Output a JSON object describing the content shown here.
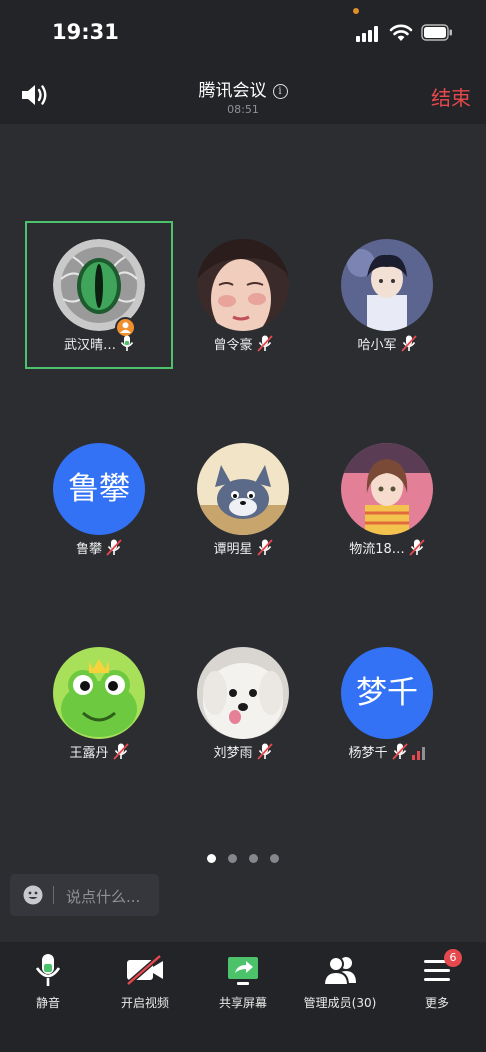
{
  "status_bar": {
    "time": "19:31"
  },
  "header": {
    "title": "腾讯会议",
    "duration": "08:51",
    "end_label": "结束"
  },
  "participants": [
    {
      "name": "武汉晴…",
      "avatar": "dragon-eye-photo",
      "mic": "on",
      "host": true
    },
    {
      "name": "曾令豪",
      "avatar": "illustrated-face",
      "mic": "muted"
    },
    {
      "name": "哈小军",
      "avatar": "anime-boy",
      "mic": "muted"
    },
    {
      "name": "鲁攀",
      "avatar_text": "鲁攀",
      "mic": "muted"
    },
    {
      "name": "谭明星",
      "avatar": "cartoon-cat",
      "mic": "muted"
    },
    {
      "name": "物流18…",
      "avatar": "anime-girl",
      "mic": "muted"
    },
    {
      "name": "王露丹",
      "avatar": "cartoon-frog",
      "mic": "muted"
    },
    {
      "name": "刘梦雨",
      "avatar": "white-puppy",
      "mic": "muted"
    },
    {
      "name": "杨梦千",
      "avatar_text": "梦千",
      "mic": "muted",
      "signal": true
    }
  ],
  "pager": {
    "pages": 4,
    "current": 1
  },
  "chat": {
    "placeholder": "说点什么..."
  },
  "toolbar": {
    "mute_label": "静音",
    "video_label": "开启视频",
    "share_label": "共享屏幕",
    "members_label": "管理成员(30)",
    "more_label": "更多",
    "more_badge": "6"
  },
  "colors": {
    "accent_green": "#4cc36a",
    "end_red": "#e5484d",
    "avatar_blue": "#3371f5",
    "host_orange": "#ef8f2d"
  }
}
